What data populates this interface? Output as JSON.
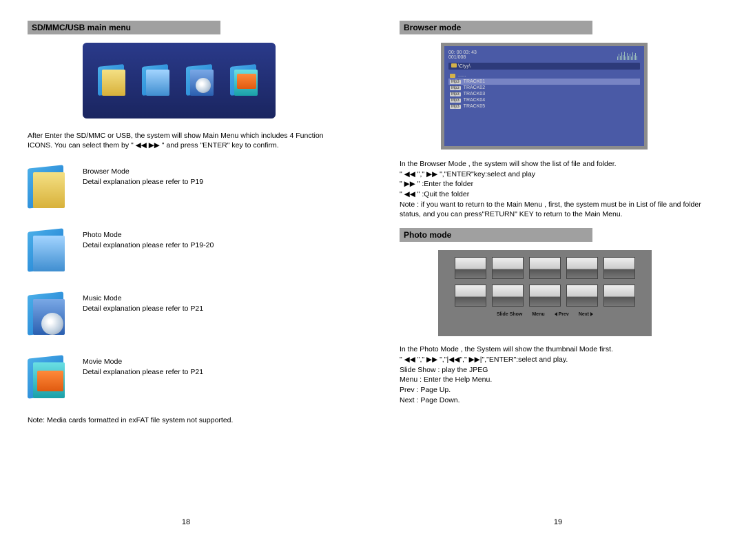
{
  "left": {
    "header": "SD/MMC/USB main menu",
    "intro": "After Enter the SD/MMC or USB, the system will show Main Menu which includes 4 Function ICONS. You can select them by \" ◀◀ ▶▶ \" and press \"ENTER\" key to confirm.",
    "modes": [
      {
        "title": "Browser Mode",
        "detail": "Detail explanation please refer to P19"
      },
      {
        "title": "Photo Mode",
        "detail": "Detail explanation please refer to P19-20"
      },
      {
        "title": "Music  Mode",
        "detail": "Detail explanation please refer to P21"
      },
      {
        "title": "Movie  Mode",
        "detail": "Detail explanation please refer to P21"
      }
    ],
    "note": "Note: Media cards formatted in exFAT file system not supported.",
    "page": "18"
  },
  "right": {
    "browser_header": "Browser mode",
    "browser_fig": {
      "time": "00:  00  03:  43",
      "counter": "001/008",
      "path": "\\Ctyy\\",
      "dots": "......",
      "tracks": [
        "TRACK01",
        "TRACK02",
        "TRACK03",
        "TRACK04",
        "TRACK05"
      ]
    },
    "browser_desc": "In the Browser Mode , the system will show the list of file and folder.\n\" ◀◀ \",\" ▶▶ \",\"ENTER\"key:select and play\n\" ▶▶ \" :Enter the folder\n\" ◀◀ \" :Quit the folder\nNote : if you want to return to the Main Menu , first, the system must be in List of file and folder status, and  you can press\"RETURN\" KEY to return to the Main Menu.",
    "photo_header": "Photo mode",
    "photo_bar": {
      "slideshow": "Slide Show",
      "menu": "Menu",
      "prev": "Prev",
      "next": "Next"
    },
    "photo_desc": "In the Photo Mode , the System will show the thumbnail Mode first.\n\" ◀◀ \",\" ▶▶ \",\"|◀◀\",\" ▶▶|\",\"ENTER\":select and play.\nSlide Show : play the JPEG\nMenu : Enter the Help  Menu.\nPrev : Page Up.\nNext : Page Down.",
    "page": "19"
  }
}
